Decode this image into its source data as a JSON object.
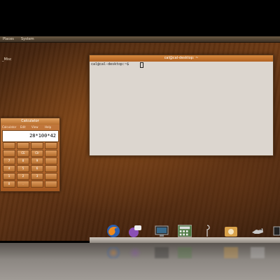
{
  "top_panel": {
    "items": [
      "Places",
      "System"
    ]
  },
  "desktop": {
    "label": "_Misc"
  },
  "terminal": {
    "title": "cal@cal-desktop: ~",
    "prompt": "cal@cal-desktop:~$"
  },
  "calculator": {
    "title": "Calculator",
    "menu": [
      "Calculator",
      "Edit",
      "View",
      "Help"
    ],
    "display": "28*100*42",
    "keys": [
      "",
      "",
      "",
      "",
      "",
      "CE",
      "Clr",
      "",
      "7",
      "8",
      "9",
      "",
      "4",
      "5",
      "6",
      "",
      "1",
      "2",
      "3",
      "",
      "0",
      ".",
      "",
      ""
    ]
  },
  "dock": {
    "icons": [
      "firefox-icon",
      "chat-icon",
      "monitor-icon",
      "calculator-app-icon",
      "pin-icon",
      "disk-icon",
      "gnu-icon",
      "terminal-icon"
    ]
  },
  "colors": {
    "accent": "#c8782f",
    "terminal_bg": "#dcd6cf",
    "panel": "#4b3d2e"
  }
}
